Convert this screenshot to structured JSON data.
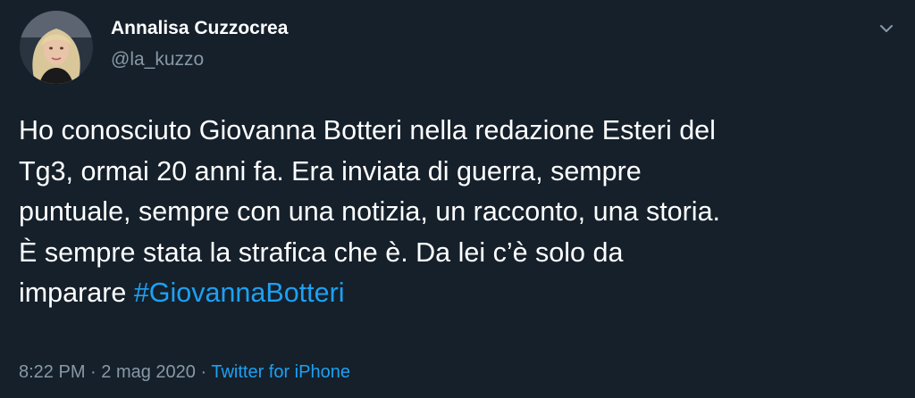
{
  "author": {
    "name": "Annalisa Cuzzocrea",
    "handle": "@la_kuzzo"
  },
  "tweet": {
    "lines": [
      "Ho conosciuto Giovanna Botteri nella redazione Esteri del",
      "Tg3, ormai 20 anni fa. Era inviata di guerra, sempre",
      "puntuale, sempre con una notizia, un racconto, una storia.",
      "È sempre stata la strafica che è. Da lei c’è solo da",
      "imparare "
    ],
    "hashtag": "#GiovannaBotteri"
  },
  "meta": {
    "time": "8:22 PM",
    "separator1": " · ",
    "date": "2 mag 2020",
    "separator2": " · ",
    "source": "Twitter for iPhone"
  },
  "icons": {
    "menu": "chevron-down-icon"
  },
  "colors": {
    "background": "#15202b",
    "text": "#ffffff",
    "secondary": "#8899a6",
    "accent": "#1da1f2"
  }
}
